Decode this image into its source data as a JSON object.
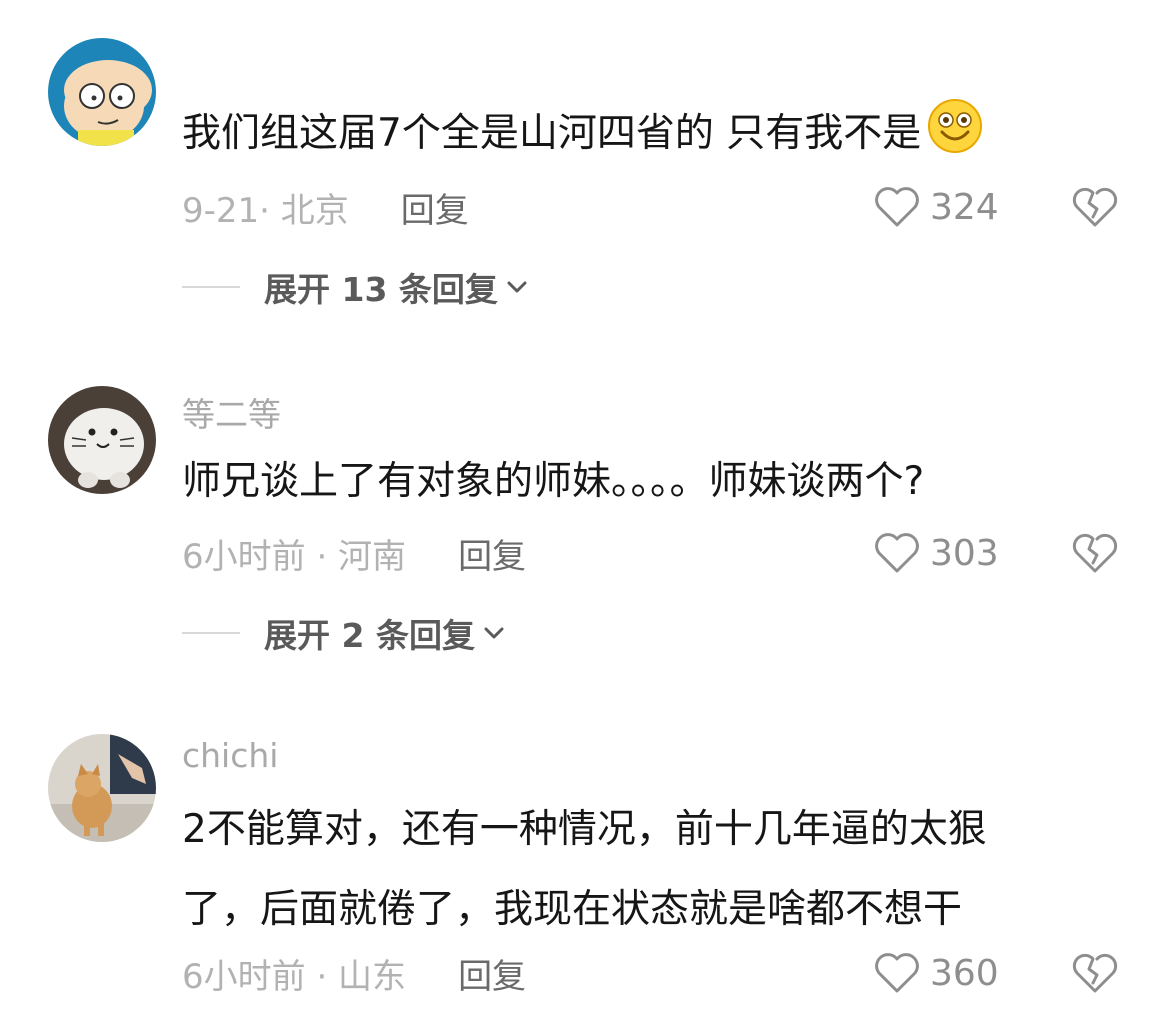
{
  "comments": [
    {
      "avatar": "cartoon-baby-avatar",
      "username": "",
      "lines": [
        "我们组这届7个全是山河四省的 只有我不是"
      ],
      "emoji": "grinning-emoji",
      "time_location": "9-21· 北京",
      "reply_label": "回复",
      "likes": "324",
      "expand_label": "展开 13 条回复"
    },
    {
      "avatar": "white-seal-plush-avatar",
      "username": "等二等",
      "lines": [
        "师兄谈上了有对象的师妹。。。。师妹谈两个?"
      ],
      "time_location": "6小时前 · 河南",
      "reply_label": "回复",
      "likes": "303",
      "expand_label": "展开 2 条回复"
    },
    {
      "avatar": "dog-photo-avatar",
      "username": "chichi",
      "lines": [
        "2不能算对，还有一种情况，前十几年逼的太狠",
        "了，后面就倦了，我现在状态就是啥都不想干"
      ],
      "time_location": "6小时前 · 山东",
      "reply_label": "回复",
      "likes": "360"
    }
  ],
  "colors": {
    "text": "#161616",
    "meta": "#b2b2b2",
    "reply": "#6a6a6a",
    "icon": "#8e8e8e",
    "avatar1_bg": "#1e85b8"
  }
}
